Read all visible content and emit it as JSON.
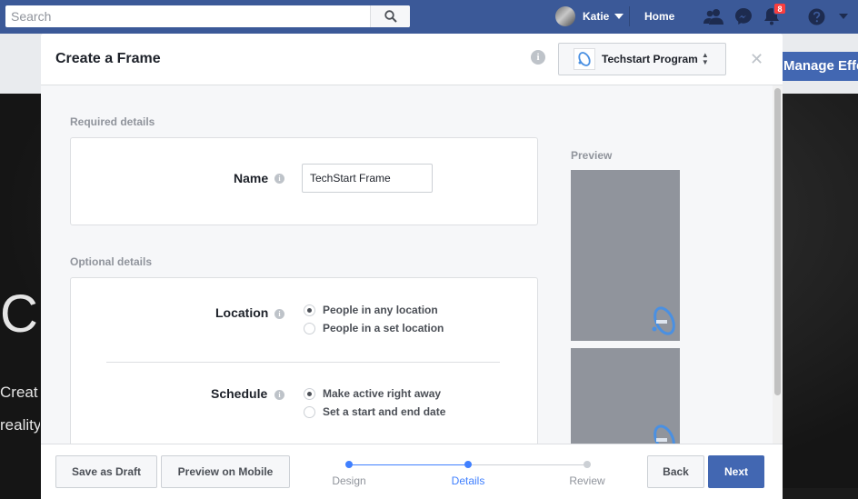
{
  "topbar": {
    "search_placeholder": "Search",
    "user_name": "Katie",
    "home_label": "Home",
    "notification_count": "8",
    "icons": [
      "search-icon",
      "friend-requests-icon",
      "messenger-icon",
      "notifications-icon",
      "help-icon",
      "account-menu-icon"
    ],
    "color": "#3b5998"
  },
  "background": {
    "button_label": "Manage Effe",
    "hero_title": "Ca",
    "hero_line1": "Creat",
    "hero_line2": "reality"
  },
  "modal": {
    "title": "Create a Frame",
    "page_selector": "Techstart Program",
    "required_section": "Required details",
    "name_label": "Name",
    "name_value": "TechStart Frame",
    "optional_section": "Optional details",
    "location_label": "Location",
    "location_options": [
      {
        "label": "People in any location",
        "selected": true
      },
      {
        "label": "People in a set location",
        "selected": false
      }
    ],
    "schedule_label": "Schedule",
    "schedule_options": [
      {
        "label": "Make active right away",
        "selected": true
      },
      {
        "label": "Set a start and end date",
        "selected": false
      }
    ],
    "preview_label": "Preview"
  },
  "footer": {
    "save_draft": "Save as Draft",
    "preview_mobile": "Preview on Mobile",
    "steps": [
      {
        "label": "Design",
        "state": "done"
      },
      {
        "label": "Details",
        "state": "active"
      },
      {
        "label": "Review",
        "state": "upcoming"
      }
    ],
    "back": "Back",
    "next": "Next",
    "accent": "#4267b2"
  }
}
